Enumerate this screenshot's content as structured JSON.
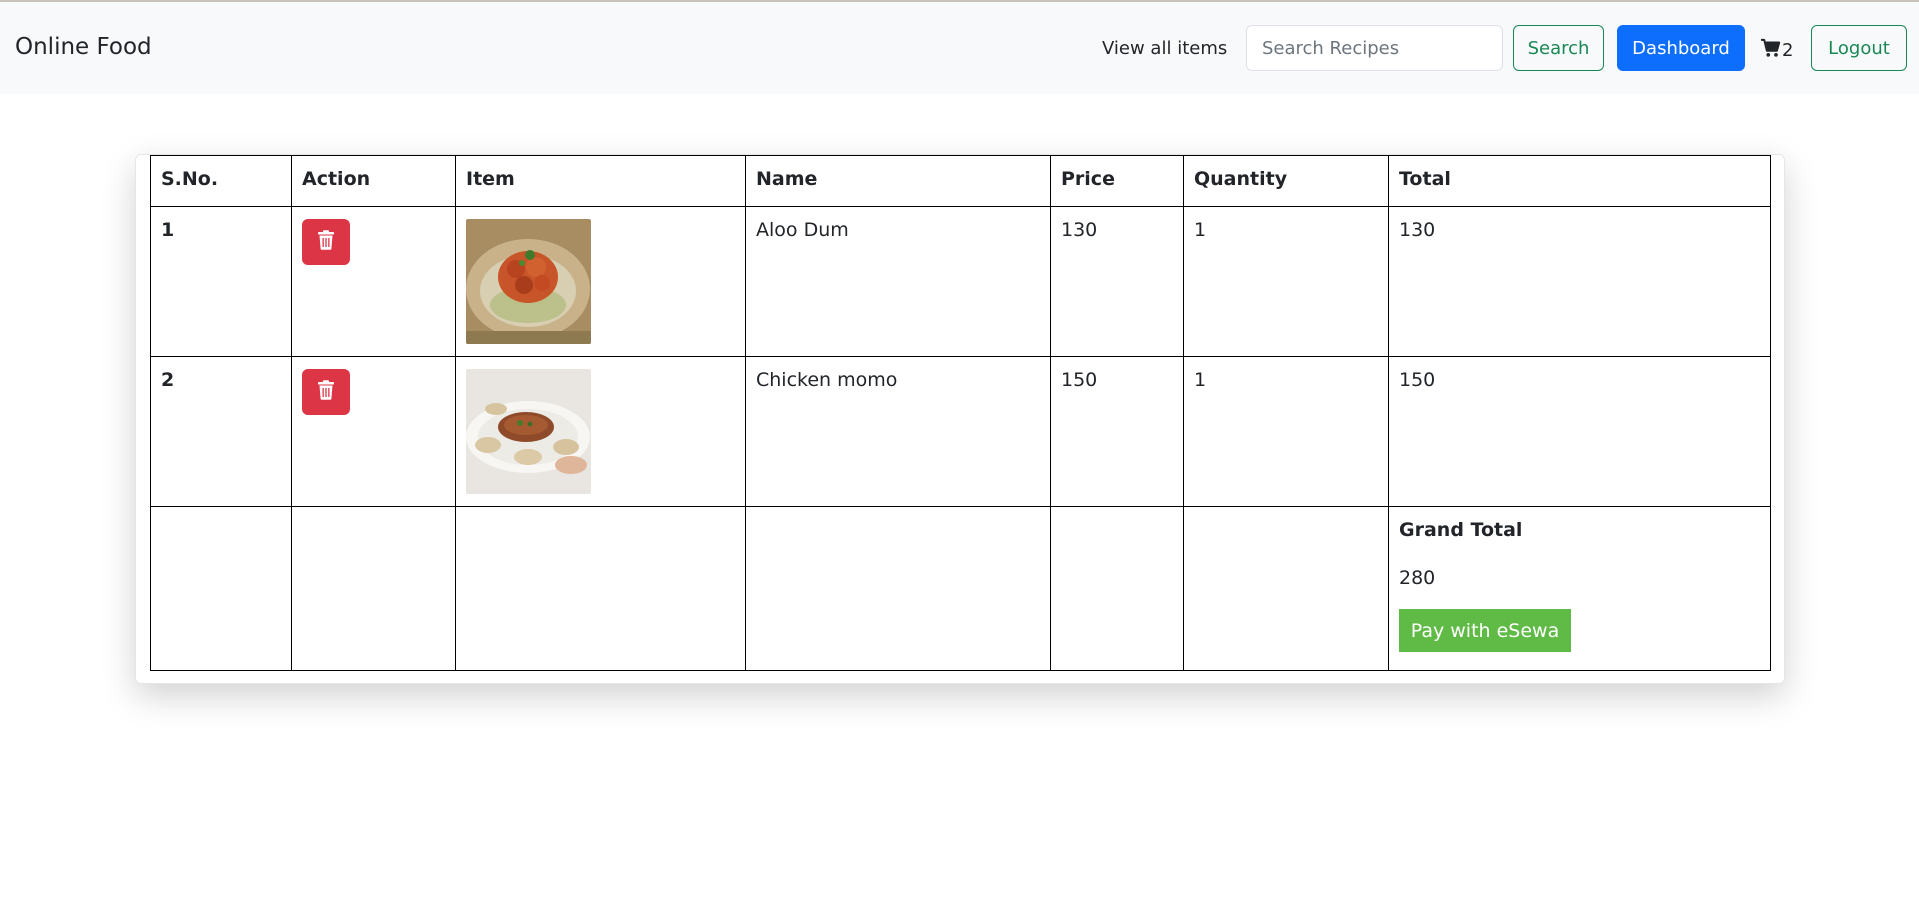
{
  "navbar": {
    "brand": "Online Food",
    "view_all": "View all items",
    "search_placeholder": "Search Recipes",
    "search_label": "Search",
    "dashboard_label": "Dashboard",
    "cart_count": "2",
    "logout_label": "Logout"
  },
  "table": {
    "headers": [
      "S.No.",
      "Action",
      "Item",
      "Name",
      "Price",
      "Quantity",
      "Total"
    ],
    "rows": [
      {
        "sno": "1",
        "name": "Aloo Dum",
        "price": "130",
        "quantity": "1",
        "total": "130",
        "image": "aloo-dum-image"
      },
      {
        "sno": "2",
        "name": "Chicken momo",
        "price": "150",
        "quantity": "1",
        "total": "150",
        "image": "chicken-momo-image"
      }
    ],
    "grand_total_label": "Grand Total",
    "grand_total_value": "280",
    "pay_label": "Pay with eSewa"
  },
  "colors": {
    "delete": "#dc3545",
    "dashboard": "#0d6efd",
    "outline_green": "#198754",
    "esewa": "#60bb46"
  }
}
